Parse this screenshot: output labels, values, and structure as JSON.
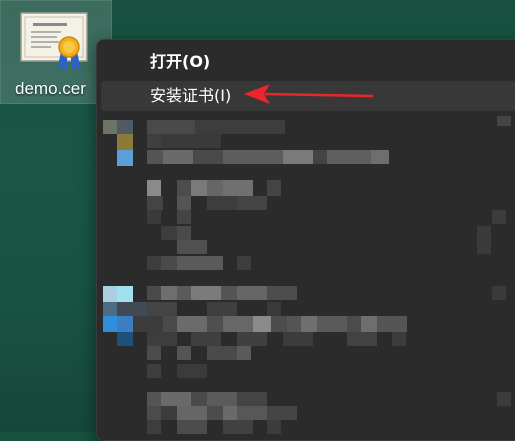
{
  "desktop": {
    "file_icon": "certificate-icon",
    "file_label": "demo.cer"
  },
  "context_menu": {
    "items": [
      {
        "label": "打开(O)",
        "bold": true
      },
      {
        "label": "安装证书(I)",
        "bold": false
      }
    ],
    "obscured_content": "pixelated"
  },
  "annotation": {
    "icon": "red-arrow-icon",
    "color": "#e8262c"
  }
}
